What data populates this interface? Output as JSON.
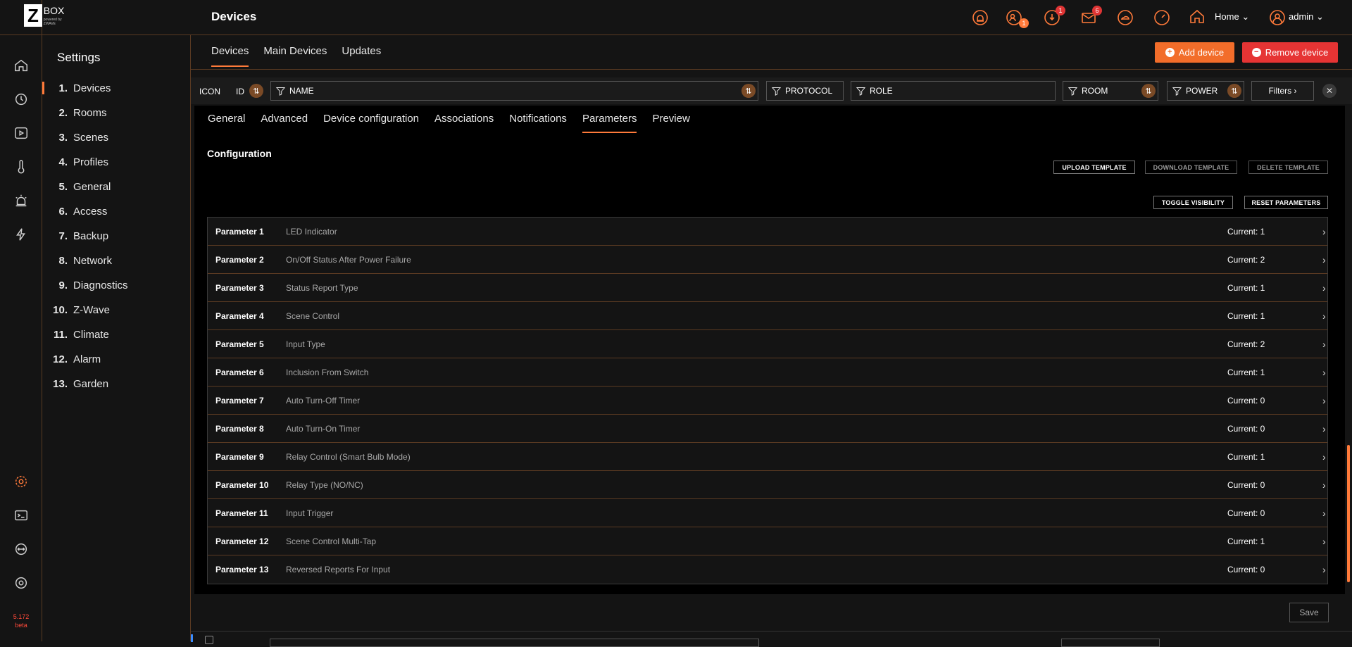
{
  "app": {
    "logo_letter": "Z",
    "logo_word": "BOX",
    "logo_sub": "powered by ZWAVE",
    "version": "5.172",
    "version_tag": "beta"
  },
  "header": {
    "title": "Devices",
    "home_label": "Home",
    "user_label": "admin",
    "badges": {
      "users": "1",
      "downloads": "1",
      "messages": "6"
    }
  },
  "settings": {
    "title": "Settings",
    "items": [
      {
        "num": "1.",
        "label": "Devices"
      },
      {
        "num": "2.",
        "label": "Rooms"
      },
      {
        "num": "3.",
        "label": "Scenes"
      },
      {
        "num": "4.",
        "label": "Profiles"
      },
      {
        "num": "5.",
        "label": "General"
      },
      {
        "num": "6.",
        "label": "Access"
      },
      {
        "num": "7.",
        "label": "Backup"
      },
      {
        "num": "8.",
        "label": "Network"
      },
      {
        "num": "9.",
        "label": "Diagnostics"
      },
      {
        "num": "10.",
        "label": "Z-Wave"
      },
      {
        "num": "11.",
        "label": "Climate"
      },
      {
        "num": "12.",
        "label": "Alarm"
      },
      {
        "num": "13.",
        "label": "Garden"
      }
    ]
  },
  "subtabs": [
    "Devices",
    "Main Devices",
    "Updates"
  ],
  "actions": {
    "add": "Add device",
    "remove": "Remove device"
  },
  "filters": {
    "icon": "ICON",
    "id": "ID",
    "name": "NAME",
    "protocol": "PROTOCOL",
    "role": "ROLE",
    "room": "ROOM",
    "power": "POWER",
    "filters_btn": "Filters"
  },
  "detail_tabs": [
    "General",
    "Advanced",
    "Device configuration",
    "Associations",
    "Notifications",
    "Parameters",
    "Preview"
  ],
  "config": {
    "title": "Configuration",
    "upload": "UPLOAD TEMPLATE",
    "download": "DOWNLOAD TEMPLATE",
    "delete": "DELETE TEMPLATE",
    "toggle": "TOGGLE VISIBILITY",
    "reset": "RESET PARAMETERS",
    "save": "Save"
  },
  "parameters": [
    {
      "name": "Parameter 1",
      "desc": "LED Indicator",
      "current": "Current: 1"
    },
    {
      "name": "Parameter 2",
      "desc": "On/Off Status After Power Failure",
      "current": "Current: 2"
    },
    {
      "name": "Parameter 3",
      "desc": "Status Report Type",
      "current": "Current: 1"
    },
    {
      "name": "Parameter 4",
      "desc": "Scene Control",
      "current": "Current: 1"
    },
    {
      "name": "Parameter 5",
      "desc": "Input Type",
      "current": "Current: 2"
    },
    {
      "name": "Parameter 6",
      "desc": "Inclusion From Switch",
      "current": "Current: 1"
    },
    {
      "name": "Parameter 7",
      "desc": "Auto Turn-Off Timer",
      "current": "Current: 0"
    },
    {
      "name": "Parameter 8",
      "desc": "Auto Turn-On Timer",
      "current": "Current: 0"
    },
    {
      "name": "Parameter 9",
      "desc": "Relay Control (Smart Bulb Mode)",
      "current": "Current: 1"
    },
    {
      "name": "Parameter 10",
      "desc": "Relay Type (NO/NC)",
      "current": "Current: 0"
    },
    {
      "name": "Parameter 11",
      "desc": "Input Trigger",
      "current": "Current: 0"
    },
    {
      "name": "Parameter 12",
      "desc": "Scene Control Multi-Tap",
      "current": "Current: 1"
    },
    {
      "name": "Parameter 13",
      "desc": "Reversed Reports For Input",
      "current": "Current: 0"
    }
  ],
  "colors": {
    "accent": "#ff7a3a",
    "danger": "#e63434",
    "background": "#141414"
  }
}
